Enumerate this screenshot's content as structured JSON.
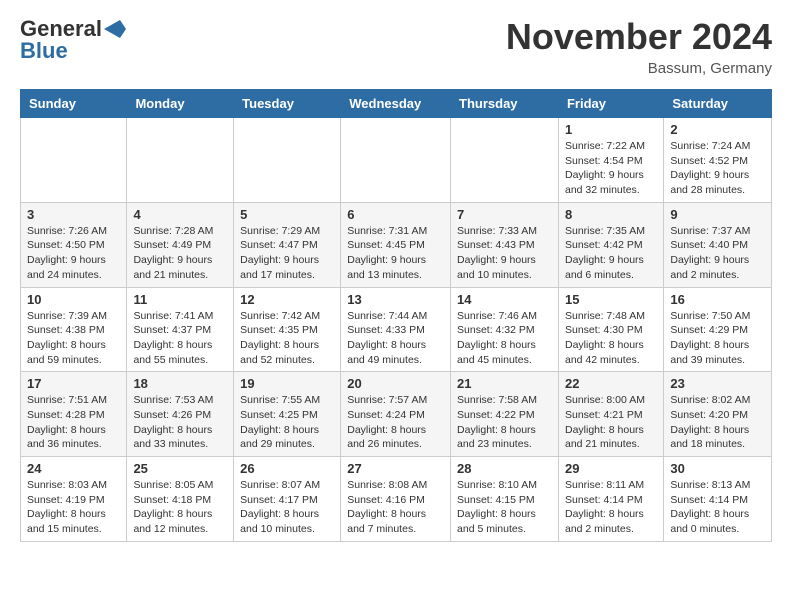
{
  "header": {
    "logo_general": "General",
    "logo_blue": "Blue",
    "month": "November 2024",
    "location": "Bassum, Germany"
  },
  "weekdays": [
    "Sunday",
    "Monday",
    "Tuesday",
    "Wednesday",
    "Thursday",
    "Friday",
    "Saturday"
  ],
  "weeks": [
    [
      {
        "day": "",
        "info": ""
      },
      {
        "day": "",
        "info": ""
      },
      {
        "day": "",
        "info": ""
      },
      {
        "day": "",
        "info": ""
      },
      {
        "day": "",
        "info": ""
      },
      {
        "day": "1",
        "info": "Sunrise: 7:22 AM\nSunset: 4:54 PM\nDaylight: 9 hours\nand 32 minutes."
      },
      {
        "day": "2",
        "info": "Sunrise: 7:24 AM\nSunset: 4:52 PM\nDaylight: 9 hours\nand 28 minutes."
      }
    ],
    [
      {
        "day": "3",
        "info": "Sunrise: 7:26 AM\nSunset: 4:50 PM\nDaylight: 9 hours\nand 24 minutes."
      },
      {
        "day": "4",
        "info": "Sunrise: 7:28 AM\nSunset: 4:49 PM\nDaylight: 9 hours\nand 21 minutes."
      },
      {
        "day": "5",
        "info": "Sunrise: 7:29 AM\nSunset: 4:47 PM\nDaylight: 9 hours\nand 17 minutes."
      },
      {
        "day": "6",
        "info": "Sunrise: 7:31 AM\nSunset: 4:45 PM\nDaylight: 9 hours\nand 13 minutes."
      },
      {
        "day": "7",
        "info": "Sunrise: 7:33 AM\nSunset: 4:43 PM\nDaylight: 9 hours\nand 10 minutes."
      },
      {
        "day": "8",
        "info": "Sunrise: 7:35 AM\nSunset: 4:42 PM\nDaylight: 9 hours\nand 6 minutes."
      },
      {
        "day": "9",
        "info": "Sunrise: 7:37 AM\nSunset: 4:40 PM\nDaylight: 9 hours\nand 2 minutes."
      }
    ],
    [
      {
        "day": "10",
        "info": "Sunrise: 7:39 AM\nSunset: 4:38 PM\nDaylight: 8 hours\nand 59 minutes."
      },
      {
        "day": "11",
        "info": "Sunrise: 7:41 AM\nSunset: 4:37 PM\nDaylight: 8 hours\nand 55 minutes."
      },
      {
        "day": "12",
        "info": "Sunrise: 7:42 AM\nSunset: 4:35 PM\nDaylight: 8 hours\nand 52 minutes."
      },
      {
        "day": "13",
        "info": "Sunrise: 7:44 AM\nSunset: 4:33 PM\nDaylight: 8 hours\nand 49 minutes."
      },
      {
        "day": "14",
        "info": "Sunrise: 7:46 AM\nSunset: 4:32 PM\nDaylight: 8 hours\nand 45 minutes."
      },
      {
        "day": "15",
        "info": "Sunrise: 7:48 AM\nSunset: 4:30 PM\nDaylight: 8 hours\nand 42 minutes."
      },
      {
        "day": "16",
        "info": "Sunrise: 7:50 AM\nSunset: 4:29 PM\nDaylight: 8 hours\nand 39 minutes."
      }
    ],
    [
      {
        "day": "17",
        "info": "Sunrise: 7:51 AM\nSunset: 4:28 PM\nDaylight: 8 hours\nand 36 minutes."
      },
      {
        "day": "18",
        "info": "Sunrise: 7:53 AM\nSunset: 4:26 PM\nDaylight: 8 hours\nand 33 minutes."
      },
      {
        "day": "19",
        "info": "Sunrise: 7:55 AM\nSunset: 4:25 PM\nDaylight: 8 hours\nand 29 minutes."
      },
      {
        "day": "20",
        "info": "Sunrise: 7:57 AM\nSunset: 4:24 PM\nDaylight: 8 hours\nand 26 minutes."
      },
      {
        "day": "21",
        "info": "Sunrise: 7:58 AM\nSunset: 4:22 PM\nDaylight: 8 hours\nand 23 minutes."
      },
      {
        "day": "22",
        "info": "Sunrise: 8:00 AM\nSunset: 4:21 PM\nDaylight: 8 hours\nand 21 minutes."
      },
      {
        "day": "23",
        "info": "Sunrise: 8:02 AM\nSunset: 4:20 PM\nDaylight: 8 hours\nand 18 minutes."
      }
    ],
    [
      {
        "day": "24",
        "info": "Sunrise: 8:03 AM\nSunset: 4:19 PM\nDaylight: 8 hours\nand 15 minutes."
      },
      {
        "day": "25",
        "info": "Sunrise: 8:05 AM\nSunset: 4:18 PM\nDaylight: 8 hours\nand 12 minutes."
      },
      {
        "day": "26",
        "info": "Sunrise: 8:07 AM\nSunset: 4:17 PM\nDaylight: 8 hours\nand 10 minutes."
      },
      {
        "day": "27",
        "info": "Sunrise: 8:08 AM\nSunset: 4:16 PM\nDaylight: 8 hours\nand 7 minutes."
      },
      {
        "day": "28",
        "info": "Sunrise: 8:10 AM\nSunset: 4:15 PM\nDaylight: 8 hours\nand 5 minutes."
      },
      {
        "day": "29",
        "info": "Sunrise: 8:11 AM\nSunset: 4:14 PM\nDaylight: 8 hours\nand 2 minutes."
      },
      {
        "day": "30",
        "info": "Sunrise: 8:13 AM\nSunset: 4:14 PM\nDaylight: 8 hours\nand 0 minutes."
      }
    ]
  ]
}
